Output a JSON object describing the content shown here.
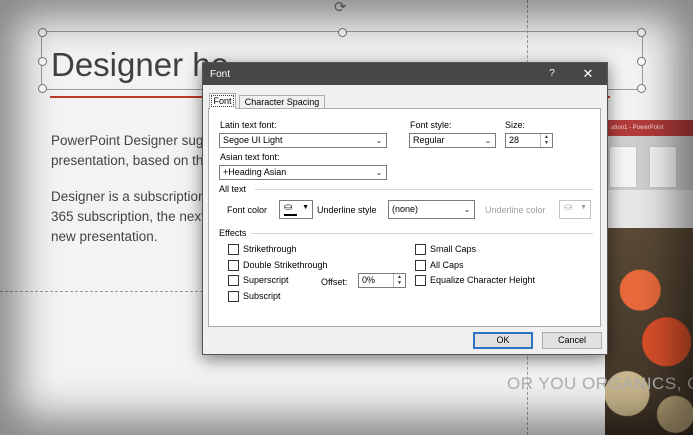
{
  "slide": {
    "title": "Designer he",
    "body_lines": [
      "PowerPoint Designer sugg",
      "presentation, based on th",
      "",
      "Designer is a subscription",
      "365 subscription, the next",
      "new presentation."
    ],
    "panel_bar_text": "ation1 - PowerPoint",
    "organics_text": "OR YOU ORGANICS, C"
  },
  "dialog": {
    "title": "Font",
    "help": "?",
    "close": "✕",
    "tabs": [
      "Font",
      "Character Spacing"
    ],
    "latin_font_label": "Latin text font:",
    "latin_font_value": "Segoe UI Light",
    "font_style_label": "Font style:",
    "font_style_value": "Regular",
    "size_label": "Size:",
    "size_value": "28",
    "asian_font_label": "Asian text font:",
    "asian_font_value": "+Heading Asian",
    "all_text_label": "All text",
    "font_color_label": "Font color",
    "underline_style_label": "Underline style",
    "underline_style_value": "(none)",
    "underline_color_label": "Underline color",
    "effects_label": "Effects",
    "effects_left": [
      "Strikethrough",
      "Double Strikethrough",
      "Superscript",
      "Subscript"
    ],
    "offset_label": "Offset:",
    "offset_value": "0%",
    "effects_right": [
      "Small Caps",
      "All Caps",
      "Equalize Character Height"
    ],
    "ok_label": "OK",
    "cancel_label": "Cancel"
  },
  "colors": {
    "title_bar": "#474747",
    "accent_red": "#c0392b",
    "ok_border": "#2b73c6"
  },
  "icons": [
    "rotate-icon",
    "paint-bucket-icon",
    "chevron-down-icon",
    "close-icon",
    "help-icon"
  ]
}
